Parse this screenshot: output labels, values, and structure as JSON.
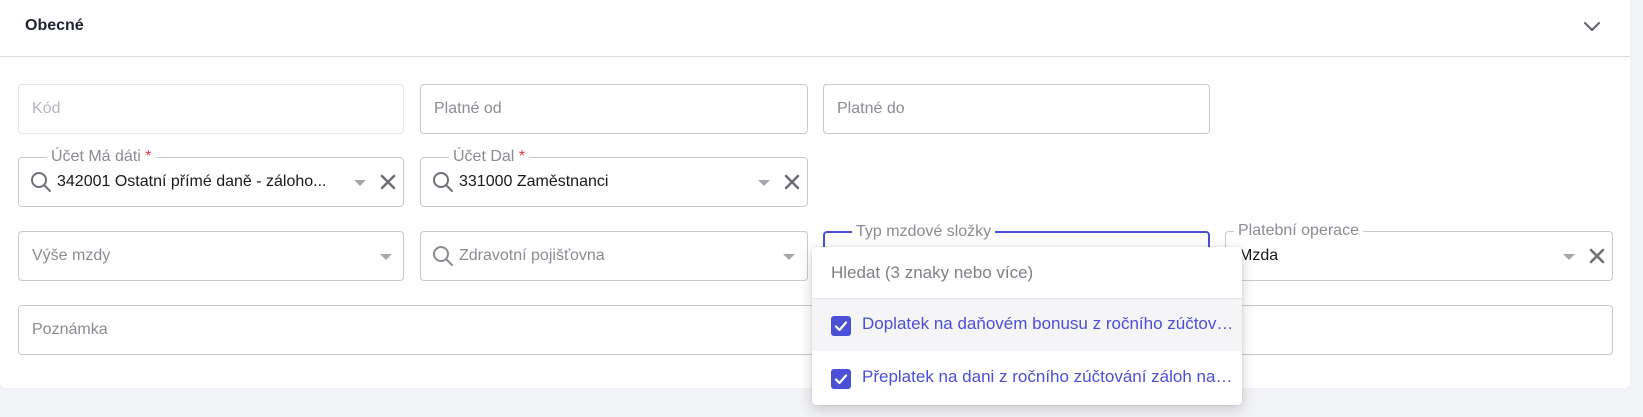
{
  "section": {
    "title": "Obecné",
    "toggle_icon": "chevron-down-icon"
  },
  "fields": {
    "kod": {
      "placeholder": "Kód"
    },
    "platne_od": {
      "placeholder": "Platné od"
    },
    "platne_do": {
      "placeholder": "Platné do"
    },
    "ucet_ma_dati": {
      "label": "Účet Má dáti",
      "required": "*",
      "value": "342001 Ostatní přímé daně - záloho..."
    },
    "ucet_dal": {
      "label": "Účet Dal",
      "required": "*",
      "value": "331000 Zaměstnanci"
    },
    "vyse_mzdy": {
      "placeholder": "Výše mzdy"
    },
    "zdravotni_pojistovna": {
      "placeholder": "Zdravotní pojišťovna"
    },
    "typ_mzdove_slozky": {
      "label": "Typ mzdové složky"
    },
    "platebni_operace": {
      "label": "Platební operace",
      "value": "Mzda"
    },
    "poznamka": {
      "placeholder": "Poznámka"
    }
  },
  "dropdown": {
    "search_placeholder": "Hledat (3 znaky nebo více)",
    "options": [
      {
        "label": "Doplatek na daňovém bonusu z ročního zúčtování",
        "checked": true
      },
      {
        "label": "Přeplatek na dani z ročního zúčtování záloh na daň",
        "checked": true
      }
    ]
  },
  "colors": {
    "accent": "#4a4fd8",
    "required": "#e03b3b",
    "border": "#c9cad0"
  }
}
